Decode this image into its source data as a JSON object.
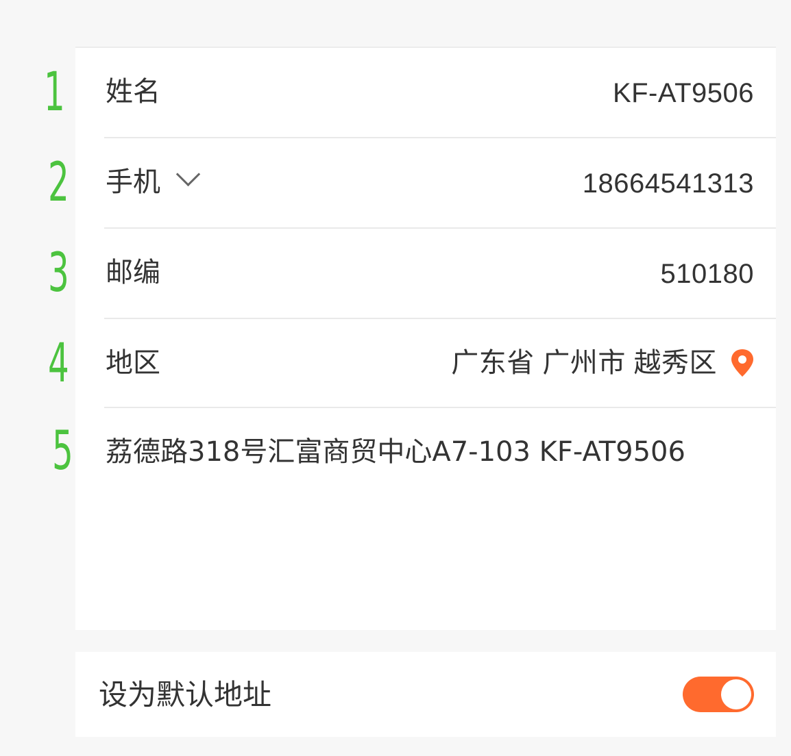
{
  "form": {
    "name": {
      "label": "姓名",
      "value": "KF-AT9506"
    },
    "phone": {
      "label": "手机",
      "value": "18664541313"
    },
    "postcode": {
      "label": "邮编",
      "value": "510180"
    },
    "region": {
      "label": "地区",
      "value": "广东省 广州市 越秀区"
    },
    "address": {
      "value": "荔德路318号汇富商贸中心A7-103 KF-AT9506"
    }
  },
  "settings": {
    "default_address_label": "设为默认地址",
    "default_address_enabled": true
  },
  "markers": [
    "1",
    "2",
    "3",
    "4",
    "5"
  ],
  "colors": {
    "accent": "#ff6a2e",
    "marker": "#4cc33f",
    "text": "#333333",
    "divider": "#e9e9e9"
  },
  "icons": {
    "phone_type": "chevron-down-icon",
    "region_locate": "location-pin-icon"
  }
}
